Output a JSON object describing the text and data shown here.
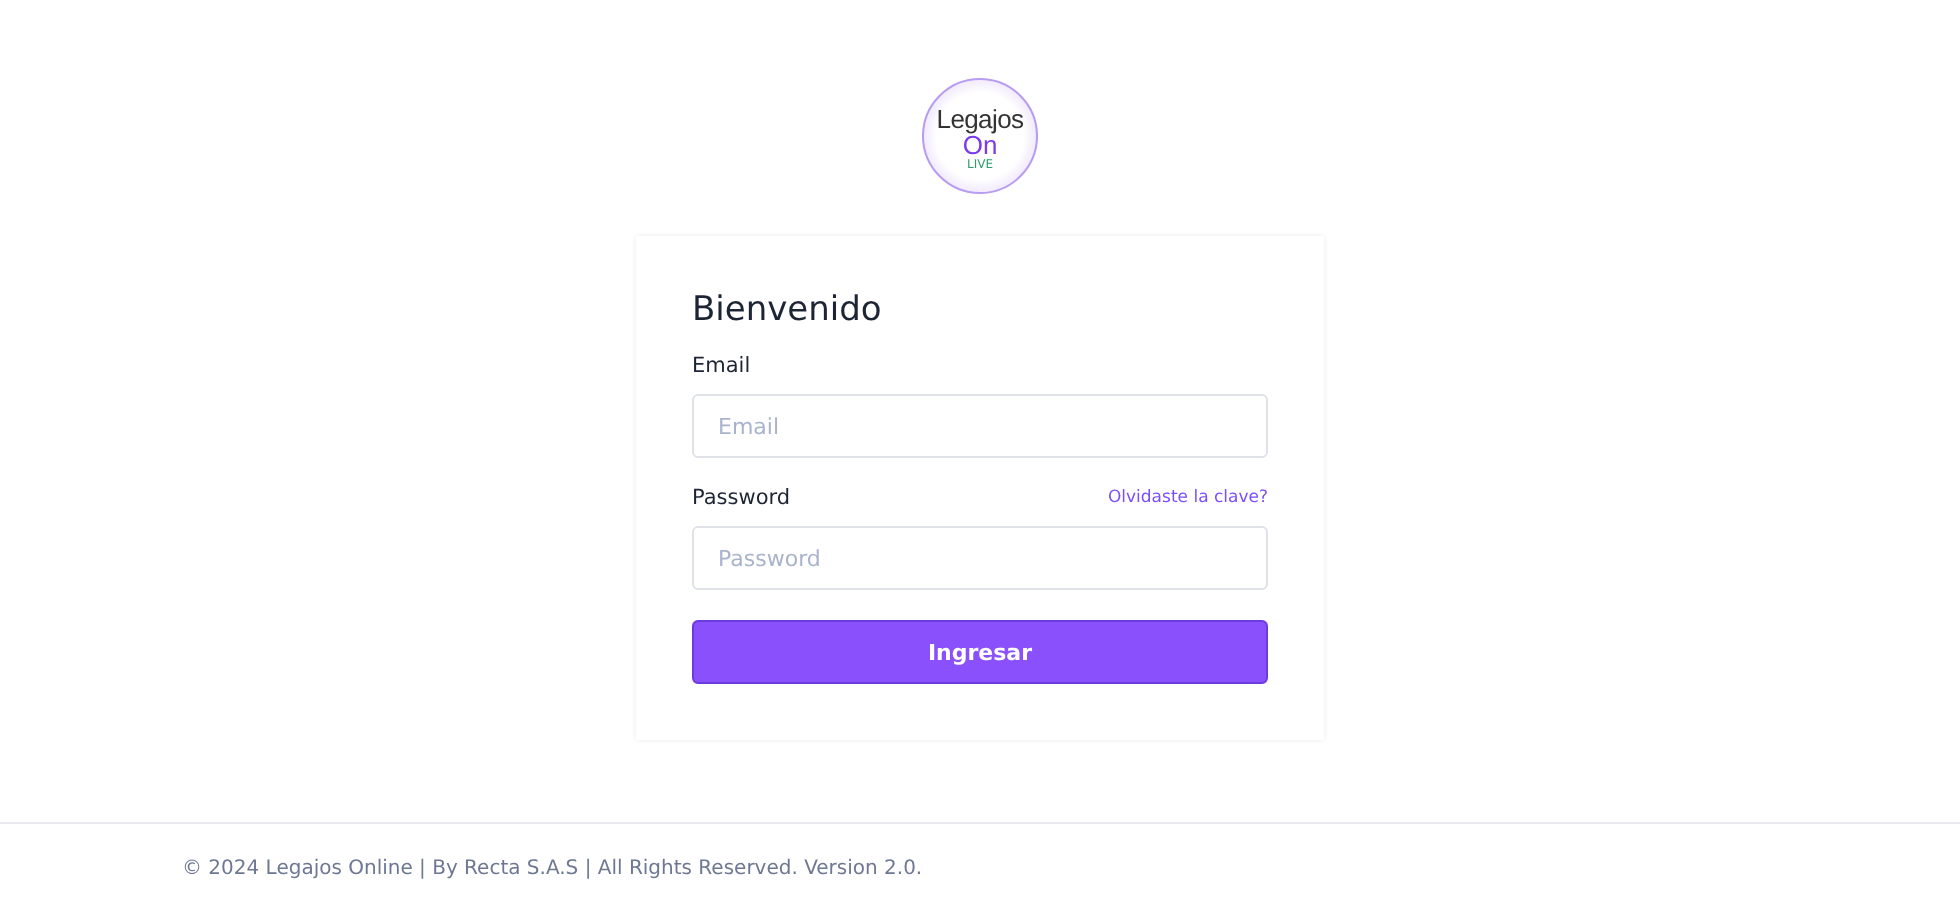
{
  "logo": {
    "line_1": "Legajos",
    "line_2": "On",
    "tag": "LIVE"
  },
  "login": {
    "title": "Bienvenido",
    "fields": [
      {
        "label": "Email",
        "placeholder": "Email"
      },
      {
        "label": "Password",
        "placeholder": "Password",
        "link": "Olvidaste la clave?"
      }
    ],
    "button": "Ingresar"
  },
  "footer": "© 2024 Legajos Online | By Recta S.A.S | All Rights Reserved. Version 2.0."
}
